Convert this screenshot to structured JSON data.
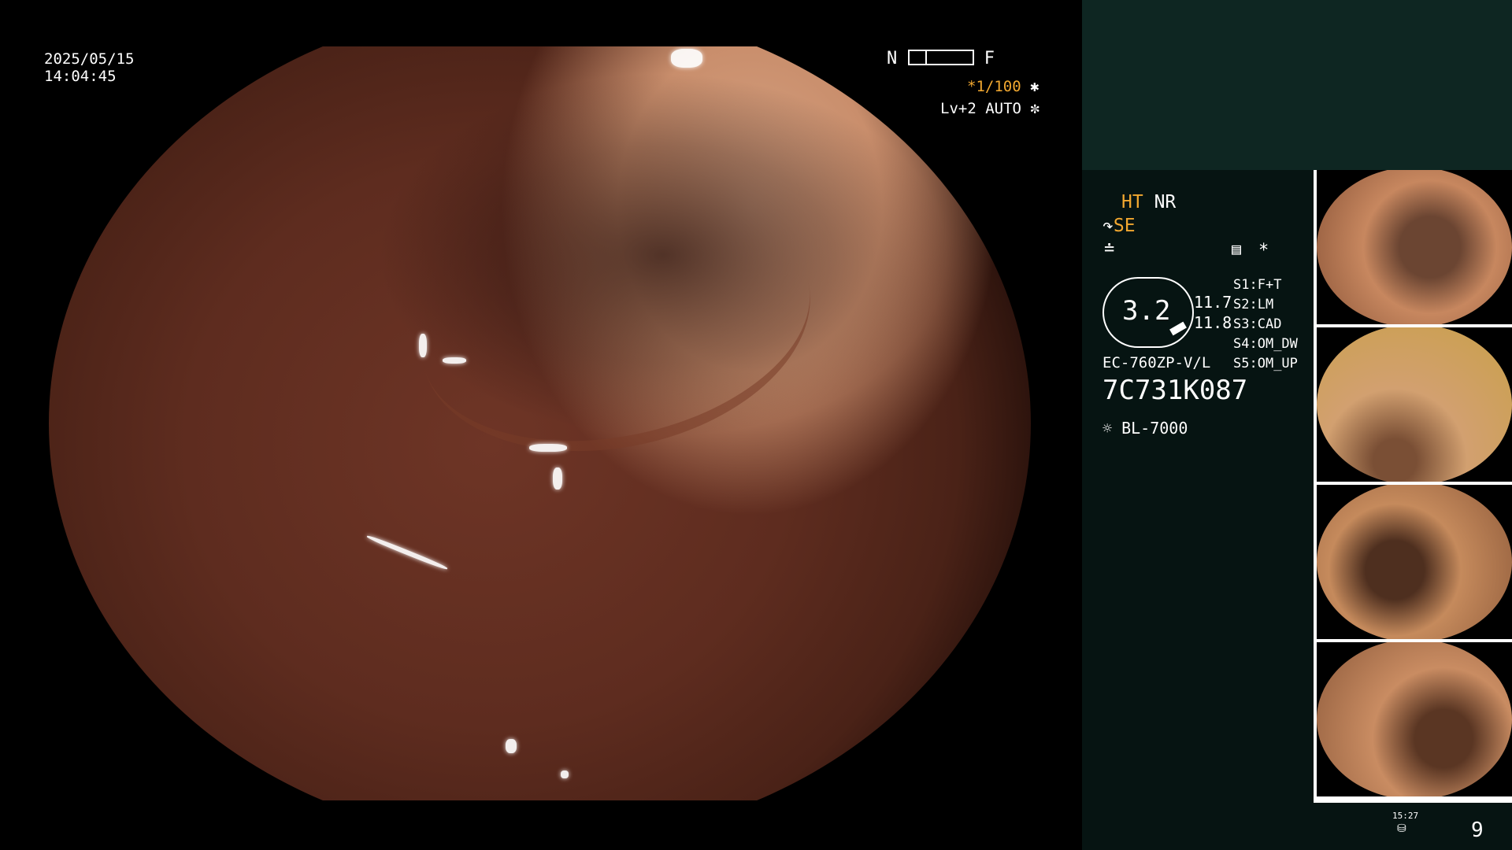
{
  "header": {
    "date": "2025/05/15",
    "time": "14:04:45"
  },
  "focus": {
    "near_label": "N",
    "far_label": "F"
  },
  "magnification": {
    "value": "*1/100"
  },
  "exposure": {
    "level": "Lv+2",
    "mode": "AUTO"
  },
  "enhancement": {
    "ht": "HT",
    "nr": "NR",
    "se": "SE",
    "switches": [
      {
        "key": "S1:",
        "value": "F+T"
      },
      {
        "key": "S2:",
        "value": "LM"
      },
      {
        "key": "S3:",
        "value": "CAD"
      },
      {
        "key": "S4:",
        "value": "OM_DW"
      },
      {
        "key": "S5:",
        "value": "OM_UP"
      }
    ],
    "star": "*"
  },
  "gauge": {
    "main_value": "3.2",
    "value_top": "11.7",
    "value_bottom": "11.8"
  },
  "scope": {
    "model": "EC-760ZP-V/L",
    "serial": "7C731K087",
    "light_source": "BL-7000"
  },
  "footer": {
    "time": "15:27",
    "image_count": "9"
  },
  "thumbnails": [
    {
      "tone": "#c7875f",
      "lumen": "#6b4532"
    },
    {
      "tone": "#d2a070",
      "lumen": "#7a4f35"
    },
    {
      "tone": "#c58a5c",
      "lumen": "#4e2f1f"
    },
    {
      "tone": "#c98c62",
      "lumen": "#5a3623"
    }
  ],
  "colors": {
    "accent_amber": "#f2a830",
    "panel_dark": "#061412",
    "panel_teal": "#0e2622"
  },
  "icons": [
    "scope-angle-icon",
    "edge-icon",
    "shutter-icon",
    "auto-iris-icon",
    "structure-icon",
    "lamp-icon",
    "storage-icon"
  ]
}
